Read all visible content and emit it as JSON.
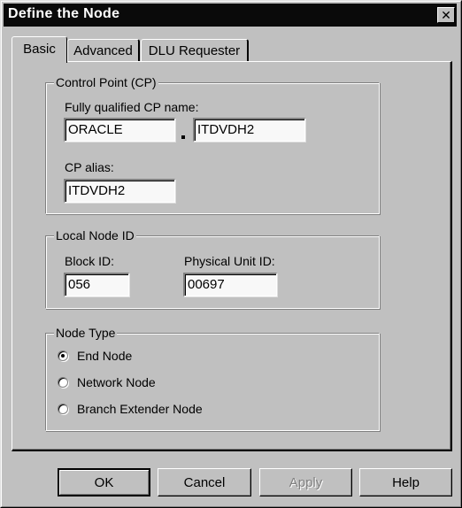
{
  "window": {
    "title": "Define the Node",
    "close_glyph": "✕"
  },
  "tabs": [
    {
      "label": "Basic",
      "selected": true
    },
    {
      "label": "Advanced",
      "selected": false
    },
    {
      "label": "DLU Requester",
      "selected": false
    }
  ],
  "control_point": {
    "group_label": "Control Point (CP)",
    "fq_name_label": "Fully qualified CP name:",
    "network_name": "ORACLE",
    "separator": ".",
    "cp_name": "ITDVDH2",
    "alias_label": "CP alias:",
    "alias": "ITDVDH2"
  },
  "local_node_id": {
    "group_label": "Local Node ID",
    "block_id_label": "Block ID:",
    "block_id": "056",
    "pu_id_label": "Physical Unit ID:",
    "pu_id": "00697"
  },
  "node_type": {
    "group_label": "Node Type",
    "options": [
      {
        "label": "End Node",
        "checked": true
      },
      {
        "label": "Network Node",
        "checked": false
      },
      {
        "label": "Branch Extender Node",
        "checked": false
      }
    ]
  },
  "buttons": {
    "ok": "OK",
    "cancel": "Cancel",
    "apply": "Apply",
    "help": "Help"
  }
}
